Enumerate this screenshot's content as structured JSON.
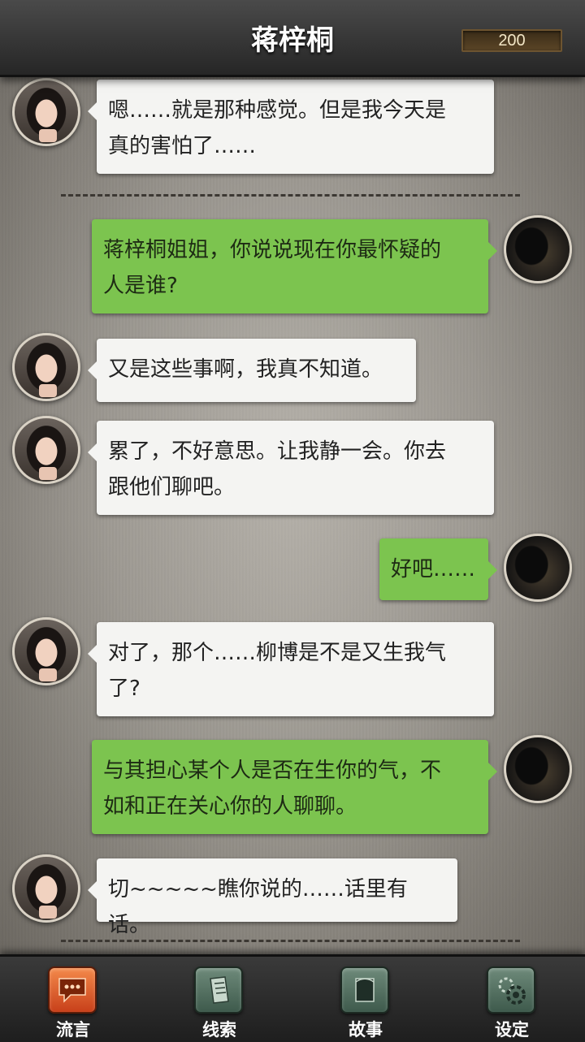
{
  "header": {
    "title": "蒋梓桐",
    "coins": "200"
  },
  "messages": [
    {
      "side": "left",
      "avatar": "girl-avatar",
      "lines": [
        "嗯……就是那种感觉。但是我今天是",
        "真的害怕了……"
      ]
    },
    {
      "side": "right",
      "avatar": "player-avatar",
      "lines": [
        "蒋梓桐姐姐，你说说现在你最怀疑的",
        "人是谁?"
      ]
    },
    {
      "side": "left",
      "avatar": "girl-avatar",
      "lines": [
        "又是这些事啊，我真不知道。"
      ]
    },
    {
      "side": "left",
      "avatar": "girl-avatar",
      "lines": [
        "累了，不好意思。让我静一会。你去",
        "跟他们聊吧。"
      ]
    },
    {
      "side": "right",
      "avatar": "player-avatar",
      "lines": [
        "好吧……"
      ]
    },
    {
      "side": "left",
      "avatar": "girl-avatar",
      "lines": [
        "对了，那个……柳博是不是又生我气",
        "了?"
      ]
    },
    {
      "side": "right",
      "avatar": "player-avatar",
      "lines": [
        "与其担心某个人是否在生你的气，不",
        "如和正在关心你的人聊聊。"
      ]
    },
    {
      "side": "left",
      "avatar": "girl-avatar",
      "lines": [
        "切~~~~~瞧你说的……话里有话。"
      ]
    }
  ],
  "nav": [
    {
      "label": "流言",
      "icon": "chat-bubble-icon",
      "active": true
    },
    {
      "label": "线索",
      "icon": "clue-scroll-icon",
      "active": false
    },
    {
      "label": "故事",
      "icon": "story-book-icon",
      "active": false
    },
    {
      "label": "设定",
      "icon": "settings-gear-icon",
      "active": false
    }
  ],
  "colors": {
    "left_bubble": "#f4f4f2",
    "right_bubble": "#7cc44f",
    "active_tab": "#e0602c",
    "inactive_tab": "#5a7868"
  }
}
